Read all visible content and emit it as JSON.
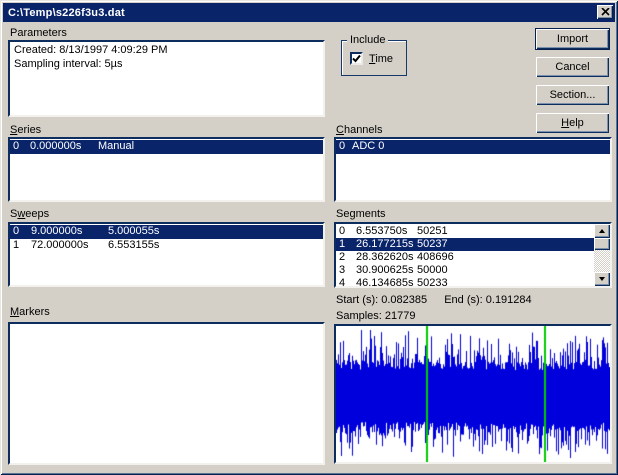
{
  "window": {
    "title": "C:\\Temp\\s226f3u3.dat"
  },
  "colors": {
    "titlebar": "#0a246a",
    "selection": "#0a246a",
    "face": "#d4d0c8",
    "shadow_dark": "#0c2d5e"
  },
  "parameters": {
    "label": "Parameters",
    "lines": [
      "Created: 8/13/1997 4:09:29 PM",
      "Sampling interval: 5µs"
    ]
  },
  "include": {
    "label": "Include",
    "checkbox": {
      "label": "&Time",
      "checked": true
    }
  },
  "buttons": {
    "import": "Import",
    "cancel": "Cancel",
    "section": "Section...",
    "help": "&Help"
  },
  "series": {
    "label": "&Series",
    "rows": [
      {
        "index": "0",
        "time": "0.000000s",
        "mode": "Manual",
        "selected": true
      }
    ]
  },
  "channels": {
    "label": "&Channels",
    "rows": [
      {
        "index": "0",
        "name": "ADC 0",
        "selected": true
      }
    ]
  },
  "sweeps": {
    "label": "S&weeps",
    "rows": [
      {
        "index": "0",
        "start": "9.000000s",
        "duration": "5.000055s",
        "selected": true
      },
      {
        "index": "1",
        "start": "72.000000s",
        "duration": "6.553155s",
        "selected": false
      }
    ]
  },
  "segments": {
    "label": "Segments",
    "rows": [
      {
        "index": "0",
        "time": "6.553750s",
        "samples": "50251",
        "selected": false
      },
      {
        "index": "1",
        "time": "26.177215s",
        "samples": "50237",
        "selected": true
      },
      {
        "index": "2",
        "time": "28.362620s",
        "samples": "408696",
        "selected": false
      },
      {
        "index": "3",
        "time": "30.900625s",
        "samples": "50000",
        "selected": false
      },
      {
        "index": "4",
        "time": "46.134685s",
        "samples": "50233",
        "selected": false
      }
    ]
  },
  "details": {
    "start_label": "Start (s):",
    "start_value": "0.082385",
    "end_label": "End (s):",
    "end_value": "0.191284",
    "samples_label": "Samples:",
    "samples_value": "21779"
  },
  "markers": {
    "label": "&Markers",
    "rows": []
  },
  "waveform": {
    "color": "#0000dd",
    "background": "#ffffff",
    "marker_color": "#00cc00",
    "marker_positions": [
      0.33,
      0.76
    ],
    "seed": 11
  }
}
